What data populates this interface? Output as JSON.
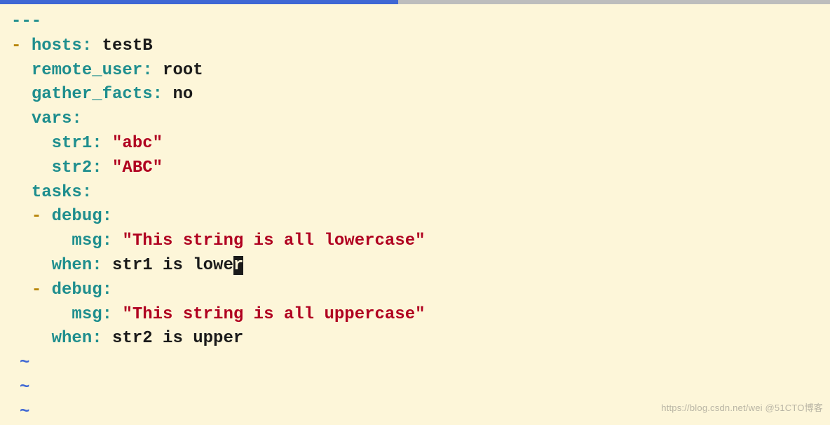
{
  "yaml": {
    "doc_start": "---",
    "dash": "-",
    "hosts_key": "hosts:",
    "hosts_val": "testB",
    "remote_user_key": "remote_user:",
    "remote_user_val": "root",
    "gather_facts_key": "gather_facts:",
    "gather_facts_val": "no",
    "vars_key": "vars:",
    "str1_key": "str1:",
    "str1_val": "\"abc\"",
    "str2_key": "str2:",
    "str2_val": "\"ABC\"",
    "tasks_key": "tasks:",
    "debug1_key": "debug:",
    "msg1_key": "msg:",
    "msg1_val": "\"This string is all lowercase\"",
    "when1_key": "when:",
    "when1_val_pre": "str1 is lowe",
    "when1_cursor": "r",
    "debug2_key": "debug:",
    "msg2_key": "msg:",
    "msg2_val": "\"This string is all uppercase\"",
    "when2_key": "when:",
    "when2_val": "str2 is upper"
  },
  "tilde": "~",
  "watermark": "https://blog.csdn.net/wei @51CTO博客"
}
